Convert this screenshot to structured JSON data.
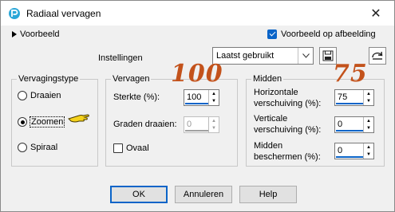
{
  "window": {
    "title": "Radiaal vervagen",
    "close_glyph": "✕"
  },
  "preview": {
    "toggle_label": "Voorbeeld",
    "preview_on_image_label": "Voorbeeld op afbeelding",
    "preview_on_image_checked": true
  },
  "settings": {
    "label": "Instellingen",
    "preset_value": "Laatst gebruikt"
  },
  "blur_type": {
    "legend": "Vervagingstype",
    "options": [
      {
        "label": "Draaien",
        "selected": false
      },
      {
        "label": "Zoomen",
        "selected": true
      },
      {
        "label": "Spiraal",
        "selected": false
      }
    ]
  },
  "blur": {
    "legend": "Vervagen",
    "strength_label": "Sterkte (%):",
    "strength_value": "100",
    "rotate_label": "Graden draaien:",
    "rotate_value": "0",
    "oval_label": "Ovaal",
    "oval_checked": false
  },
  "center": {
    "legend": "Midden",
    "h_offset_label_1": "Horizontale",
    "h_offset_label_2": "verschuiving (%):",
    "h_offset_value": "75",
    "v_offset_label_1": "Verticale",
    "v_offset_label_2": "verschuiving (%):",
    "v_offset_value": "0",
    "protect_label_1": "Midden",
    "protect_label_2": "beschermen (%):",
    "protect_value": "0"
  },
  "annotations": {
    "strength_note": "100",
    "h_offset_note": "75"
  },
  "buttons": {
    "ok": "OK",
    "cancel": "Annuleren",
    "help": "Help"
  },
  "colors": {
    "accent": "#0a64c8",
    "annotation": "#c3521b"
  }
}
